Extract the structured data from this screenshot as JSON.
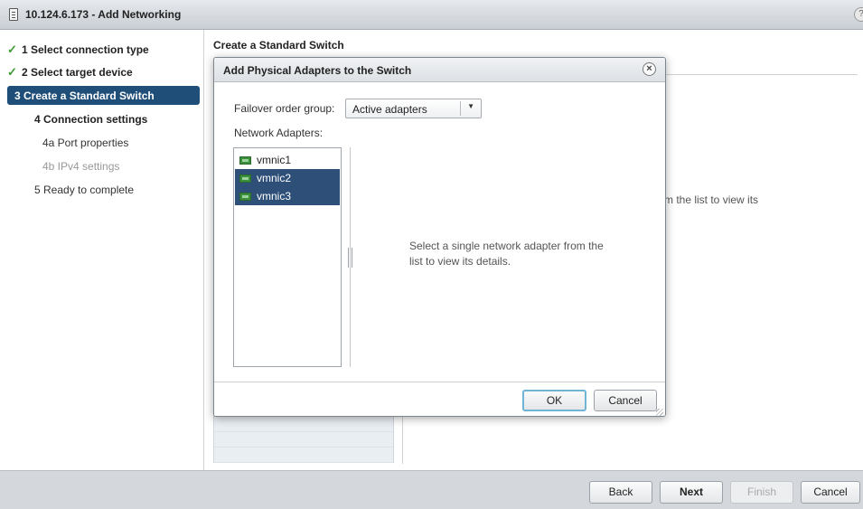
{
  "window": {
    "title": "10.124.6.173 - Add Networking"
  },
  "steps": [
    {
      "label": "1  Select connection type",
      "state": "done"
    },
    {
      "label": "2  Select target device",
      "state": "done"
    },
    {
      "label": "3  Create a Standard Switch",
      "state": "active"
    },
    {
      "label": "4  Connection settings",
      "state": "pending"
    },
    {
      "label": "4a  Port properties",
      "state": "sub"
    },
    {
      "label": "4b  IPv4 settings",
      "state": "disabled"
    },
    {
      "label": "5  Ready to complete",
      "state": "sub"
    }
  ],
  "main": {
    "title": "Create a Standard Switch",
    "detail_text": "m the list to view its"
  },
  "dialog": {
    "title": "Add Physical Adapters to the Switch",
    "failover_label": "Failover order group:",
    "failover_value": "Active adapters",
    "adapters_label": "Network Adapters:",
    "adapters": [
      {
        "name": "vmnic1",
        "selected": false
      },
      {
        "name": "vmnic2",
        "selected": true
      },
      {
        "name": "vmnic3",
        "selected": true
      }
    ],
    "details_placeholder": "Select a single network adapter from the list to view its details.",
    "ok_label": "OK",
    "cancel_label": "Cancel"
  },
  "footer": {
    "back_label": "Back",
    "next_label": "Next",
    "finish_label": "Finish",
    "cancel_label": "Cancel"
  },
  "colors": {
    "active_step": "#1f4e79",
    "selected_row": "#2d4f78",
    "check": "#3f9c35"
  },
  "icons": {
    "check": "checkmark-icon",
    "nic": "network-adapter-icon",
    "close": "close-icon",
    "dropdown": "chevron-down-icon"
  }
}
